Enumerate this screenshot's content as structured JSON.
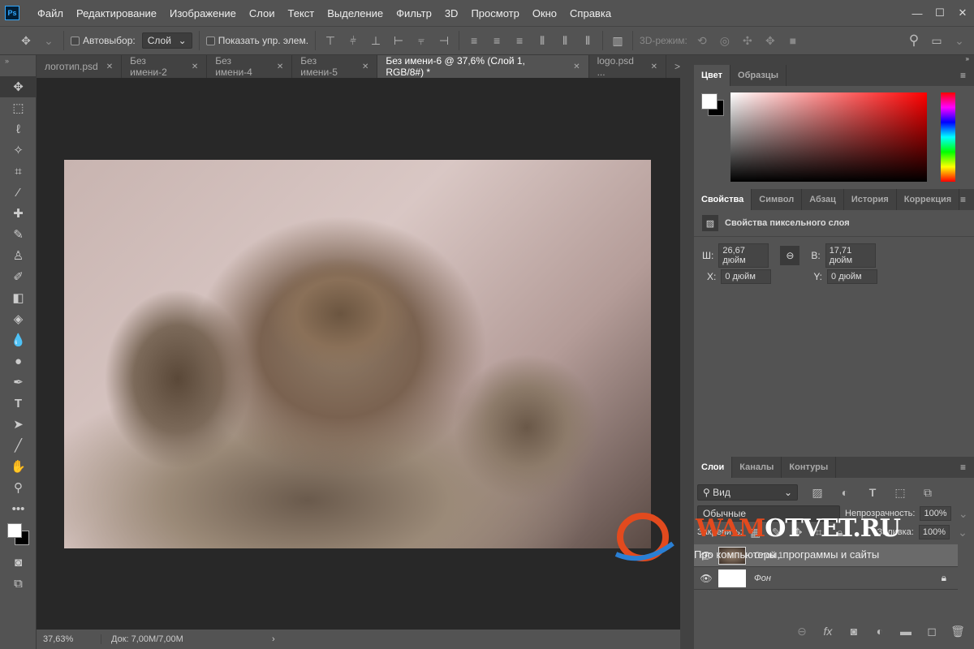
{
  "app": {
    "logo": "Ps"
  },
  "menu": [
    "Файл",
    "Редактирование",
    "Изображение",
    "Слои",
    "Текст",
    "Выделение",
    "Фильтр",
    "3D",
    "Просмотр",
    "Окно",
    "Справка"
  ],
  "window_controls": {
    "minimize": "—",
    "maximize": "☐",
    "close": "✕"
  },
  "options": {
    "autoselect_label": "Автовыбор:",
    "autoselect_value": "Слой",
    "show_transform_label": "Показать упр. элем.",
    "mode3d_label": "3D-режим:"
  },
  "tabs": [
    {
      "label": "логотип.psd",
      "active": false
    },
    {
      "label": "Без имени-2",
      "active": false
    },
    {
      "label": "Без имени-4",
      "active": false
    },
    {
      "label": "Без имени-5",
      "active": false
    },
    {
      "label": "Без имени-6 @ 37,6% (Слой 1, RGB/8#) *",
      "active": true
    },
    {
      "label": "logo.psd ...",
      "active": false
    }
  ],
  "tabs_overflow": ">>",
  "status": {
    "zoom": "37,63%",
    "doc": "Док: 7,00M/7,00M",
    "arrow": "›"
  },
  "color_panel": {
    "tabs": [
      "Цвет",
      "Образцы"
    ],
    "foreground": "#ffffff",
    "background": "#000000",
    "hue": "#ff0000"
  },
  "properties_panel": {
    "tabs": [
      "Свойства",
      "Символ",
      "Абзац",
      "История",
      "Коррекция"
    ],
    "title": "Свойства пиксельного слоя",
    "w_label": "Ш:",
    "w_value": "26,67 дюйм",
    "h_label": "В:",
    "h_value": "17,71 дюйм",
    "x_label": "X:",
    "x_value": "0 дюйм",
    "y_label": "Y:",
    "y_value": "0 дюйм"
  },
  "layers_panel": {
    "tabs": [
      "Слои",
      "Каналы",
      "Контуры"
    ],
    "filter": "Вид",
    "blend_mode": "Обычные",
    "opacity_label": "Непрозрачность:",
    "opacity": "100%",
    "lock_label": "Закрепить:",
    "fill_label": "Заливка:",
    "fill": "100%",
    "layers": [
      {
        "name": "Слой 1",
        "selected": true
      },
      {
        "name": "Фон",
        "selected": false,
        "locked": true
      }
    ]
  },
  "watermark": {
    "brand_a": "WAM",
    "brand_b": "OTVET.RU",
    "tagline": "Про компьютеры, программы и сайты"
  }
}
